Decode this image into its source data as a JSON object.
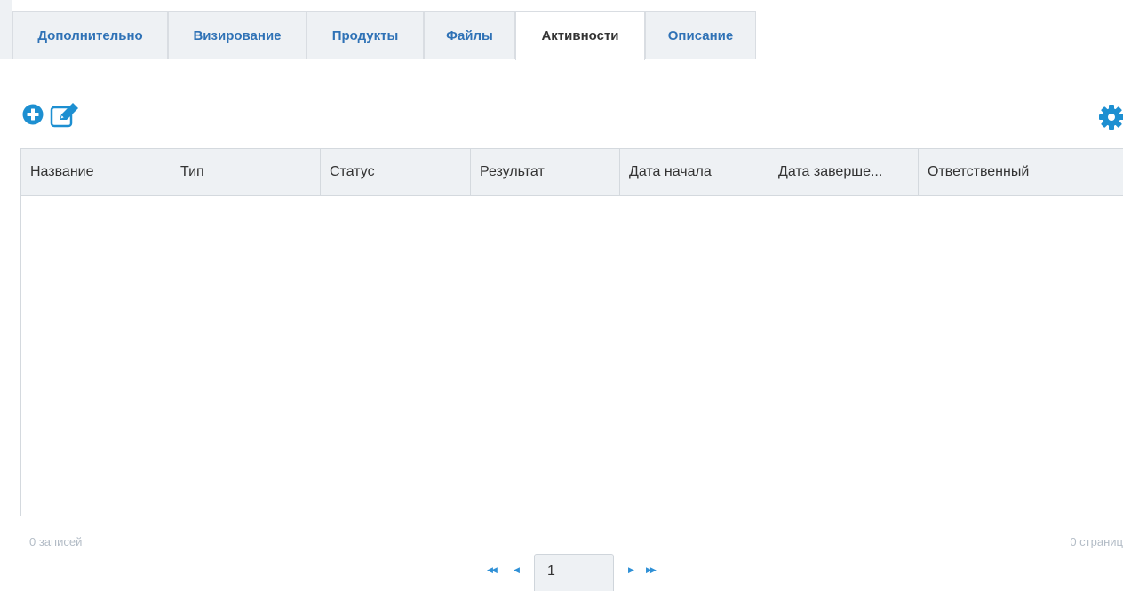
{
  "tabs": [
    {
      "label": "Дополнительно"
    },
    {
      "label": "Визирование"
    },
    {
      "label": "Продукты"
    },
    {
      "label": "Файлы"
    },
    {
      "label": "Активности",
      "active": true
    },
    {
      "label": "Описание"
    }
  ],
  "toolbar": {
    "add_icon": "plus-circle-icon",
    "edit_icon": "edit-icon",
    "settings_icon": "gear-icon",
    "accent_color": "#1d8fd1"
  },
  "grid": {
    "columns": [
      "Название",
      "Тип",
      "Статус",
      "Результат",
      "Дата начала",
      "Дата заверше...",
      "Ответственный"
    ],
    "rows": []
  },
  "footer": {
    "records": "0 записей",
    "pages": "0 страниц"
  },
  "pager": {
    "current_page": "1"
  }
}
